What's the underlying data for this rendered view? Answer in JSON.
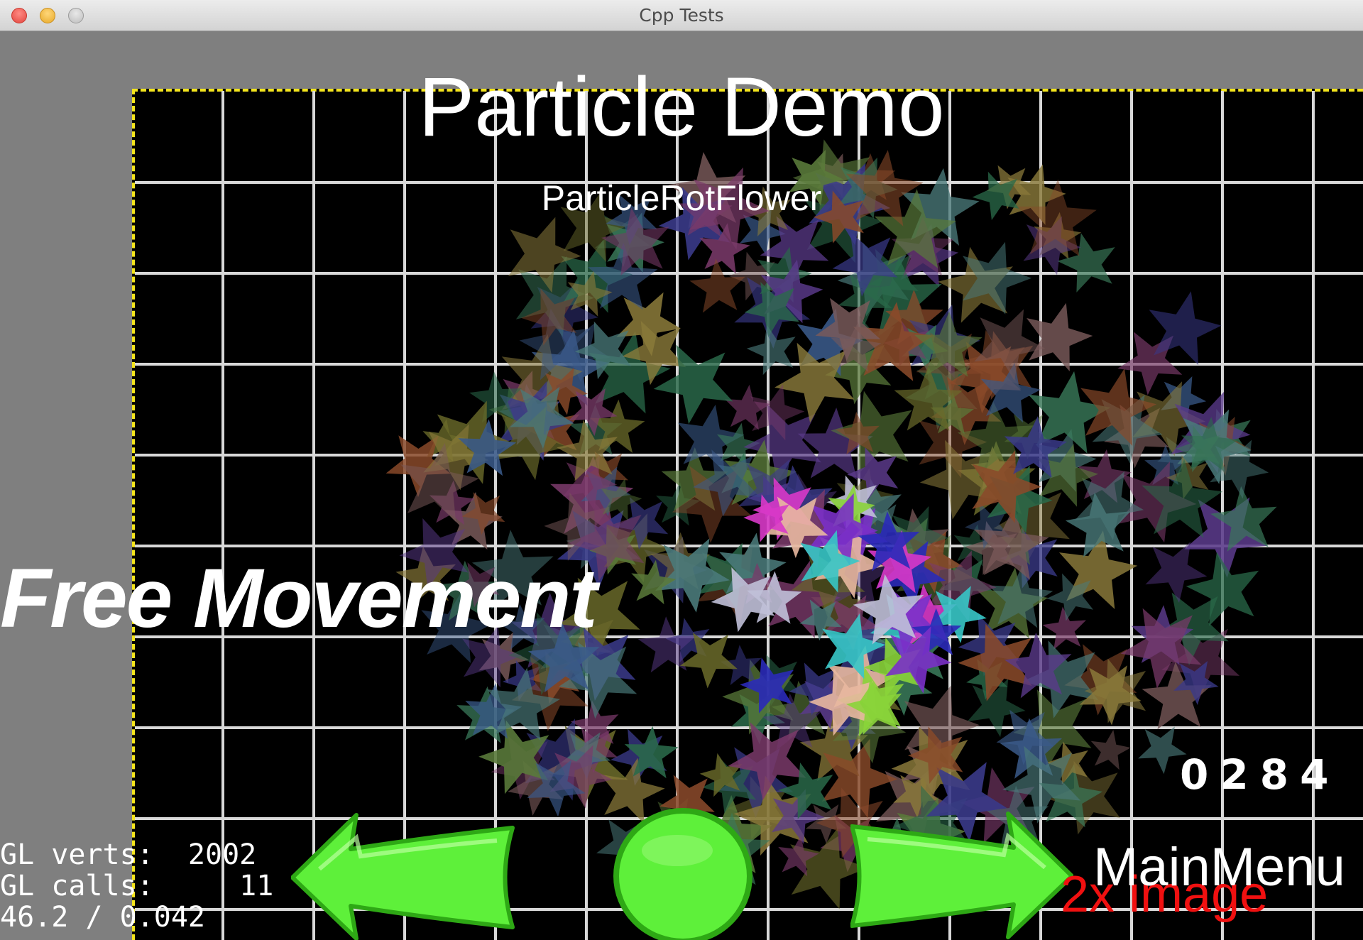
{
  "window": {
    "title": "Cpp Tests"
  },
  "scene": {
    "title": "Particle Demo",
    "subtitle": "ParticleRotFlower",
    "mode_label": "Free Movement",
    "particle_count": "0284",
    "menu_label": "MainMenu",
    "image_label": "2x image"
  },
  "stats": {
    "verts_label": "GL verts:",
    "verts_value": "2002",
    "calls_label": "GL calls:",
    "calls_value": "11",
    "fps_line": "46.2 / 0.042"
  },
  "colors": {
    "stage_border": "#f4e51d",
    "grid": "#d8d8d8",
    "button_green": "#5ef03a",
    "button_outline": "#2ea815",
    "image_label": "#f01010"
  },
  "icons": {
    "back": "left-arrow-icon",
    "restart": "circle-icon",
    "next": "right-arrow-icon"
  }
}
